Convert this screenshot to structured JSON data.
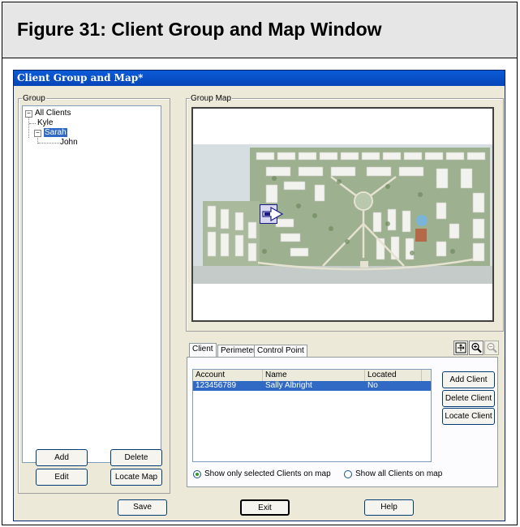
{
  "figure": {
    "title": "Figure 31:  Client Group and Map Window"
  },
  "window": {
    "title": "Client Group and Map*"
  },
  "group_panel": {
    "legend": "Group",
    "tree": {
      "root": "All Clients",
      "children": [
        "Kyle",
        "Sarah"
      ],
      "grandchildren": [
        "John"
      ]
    },
    "buttons": {
      "add": "Add",
      "delete": "Delete",
      "edit": "Edit",
      "locate_map": "Locate Map"
    }
  },
  "map_panel": {
    "legend": "Group Map"
  },
  "tabs": [
    "Client",
    "Perimeter",
    "Control Point"
  ],
  "client_list": {
    "columns": [
      "Account",
      "Name",
      "Located"
    ],
    "rows": [
      {
        "account": "123456789",
        "name": "Sally Albright",
        "located": "No"
      }
    ]
  },
  "client_buttons": {
    "add": "Add Client",
    "delete": "Delete Client",
    "locate": "Locate Client"
  },
  "radios": {
    "selected_only": "Show only selected Clients on map",
    "all": "Show all Clients on map"
  },
  "bottom_buttons": {
    "save": "Save",
    "exit": "Exit",
    "help": "Help"
  },
  "icons": {
    "fit": "fit-map-icon",
    "zoom_in": "zoom-in-icon",
    "zoom_out": "zoom-out-icon"
  },
  "colors": {
    "titlebar": "#0a55d0",
    "selection": "#316ac5",
    "window": "#ece9d8"
  }
}
